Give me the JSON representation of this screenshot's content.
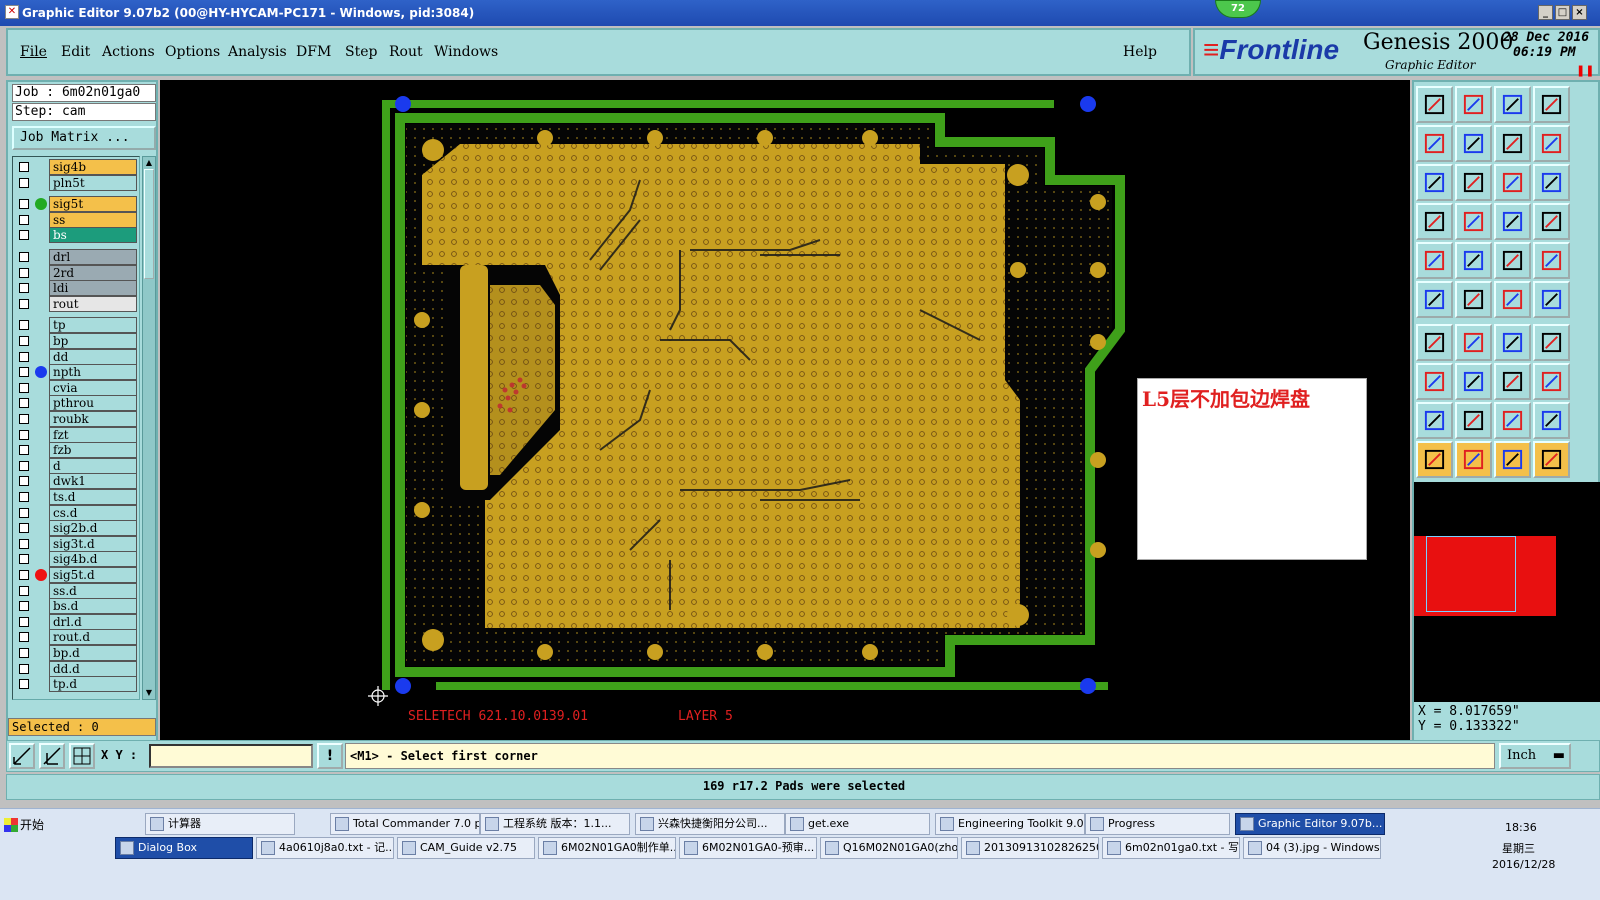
{
  "window": {
    "title": "Graphic Editor 9.07b2 (00@HY-HYCAM-PC171 - Windows, pid:3084)",
    "badge": "72",
    "min": "_",
    "max": "□",
    "close": "×"
  },
  "menu": [
    "File",
    "Edit",
    "Actions",
    "Options",
    "Analysis",
    "DFM",
    "Step",
    "Rout",
    "Windows"
  ],
  "help": "Help",
  "brand": {
    "frontline": "Frontline",
    "product": "Genesis 2000",
    "sub": "Graphic Editor",
    "date": "28 Dec 2016",
    "time": "06:19 PM",
    "pause": "❚❚"
  },
  "job": {
    "job_line": "Job : 6m02n01ga0",
    "step_line": "Step: cam",
    "matrix_button": "Job Matrix ..."
  },
  "layers": [
    {
      "name": "sig4b",
      "color": "#f4c04a",
      "dot": ""
    },
    {
      "name": "pln5t",
      "color": "#a8dcdc",
      "dot": ""
    },
    {
      "name": "sig5t",
      "color": "#f4c04a",
      "dot": "#22aa22"
    },
    {
      "name": "ss",
      "color": "#f4c04a",
      "dot": ""
    },
    {
      "name": "bs",
      "color": "#1c9c7c",
      "dot": ""
    },
    {
      "name": "drl",
      "color": "#9aaab2",
      "dot": ""
    },
    {
      "name": "2rd",
      "color": "#9aaab2",
      "dot": ""
    },
    {
      "name": "ldi",
      "color": "#9aaab2",
      "dot": ""
    },
    {
      "name": "rout",
      "color": "#e6e6e6",
      "dot": ""
    },
    {
      "name": "tp",
      "color": "#a8dcdc",
      "dot": ""
    },
    {
      "name": "bp",
      "color": "#a8dcdc",
      "dot": ""
    },
    {
      "name": "dd",
      "color": "#a8dcdc",
      "dot": ""
    },
    {
      "name": "npth",
      "color": "#a8dcdc",
      "dot": "#1a3aee"
    },
    {
      "name": "cvia",
      "color": "#a8dcdc",
      "dot": ""
    },
    {
      "name": "pthrou",
      "color": "#a8dcdc",
      "dot": ""
    },
    {
      "name": "roubk",
      "color": "#a8dcdc",
      "dot": ""
    },
    {
      "name": "fzt",
      "color": "#a8dcdc",
      "dot": ""
    },
    {
      "name": "fzb",
      "color": "#a8dcdc",
      "dot": ""
    },
    {
      "name": "d",
      "color": "#a8dcdc",
      "dot": ""
    },
    {
      "name": "dwk1",
      "color": "#a8dcdc",
      "dot": ""
    },
    {
      "name": "ts.d",
      "color": "#a8dcdc",
      "dot": ""
    },
    {
      "name": "cs.d",
      "color": "#a8dcdc",
      "dot": ""
    },
    {
      "name": "sig2b.d",
      "color": "#a8dcdc",
      "dot": ""
    },
    {
      "name": "sig3t.d",
      "color": "#a8dcdc",
      "dot": ""
    },
    {
      "name": "sig4b.d",
      "color": "#a8dcdc",
      "dot": ""
    },
    {
      "name": "sig5t.d",
      "color": "#a8dcdc",
      "dot": "#ee1111"
    },
    {
      "name": "ss.d",
      "color": "#a8dcdc",
      "dot": ""
    },
    {
      "name": "bs.d",
      "color": "#a8dcdc",
      "dot": ""
    },
    {
      "name": "drl.d",
      "color": "#a8dcdc",
      "dot": ""
    },
    {
      "name": "rout.d",
      "color": "#a8dcdc",
      "dot": ""
    },
    {
      "name": "bp.d",
      "color": "#a8dcdc",
      "dot": ""
    },
    {
      "name": "dd.d",
      "color": "#a8dcdc",
      "dot": ""
    },
    {
      "name": "tp.d",
      "color": "#a8dcdc",
      "dot": ""
    }
  ],
  "selected": "Selected : 0",
  "board": {
    "label_left": "SELETECH  621.10.0139.01",
    "label_right": "LAYER 5"
  },
  "note": "L5层不加包边焊盘",
  "coords": {
    "x": "X = 8.017659\"",
    "y": "Y = 0.133322\""
  },
  "bottom": {
    "xy_label": "X Y :",
    "xy_value": "",
    "prompt": "<M1> - Select first corner",
    "units": "Inch",
    "alert": "!"
  },
  "status": "169 r17.2 Pads were selected",
  "taskbar": {
    "start": "开始",
    "row1": [
      "计算器",
      "Total Commander 7.0 p...",
      "工程系统  版本：1.1...",
      "兴森快捷衡阳分公司...",
      "get.exe",
      "Engineering Toolkit 9.0...",
      "Progress",
      "Graphic Editor 9.07b..."
    ],
    "row2": [
      "Dialog Box",
      "4a0610j8a0.txt - 记...",
      "CAM_Guide v2.75",
      "6M02N01GA0制作单...",
      "6M02N01GA0-预审...",
      "Q16M02N01GA0(zho...",
      "20130913102826250...",
      "6m02n01ga0.txt - 写...",
      "04 (3).jpg - Windows..."
    ],
    "clock_time": "18:36",
    "clock_day": "星期三",
    "clock_date": "2016/12/28"
  },
  "colors": {
    "panel": "#a8dcdc",
    "copper": "#c8a020",
    "mask_green": "#3fa01a",
    "canvas": "#000000",
    "pad_blue": "#1a3aee"
  }
}
